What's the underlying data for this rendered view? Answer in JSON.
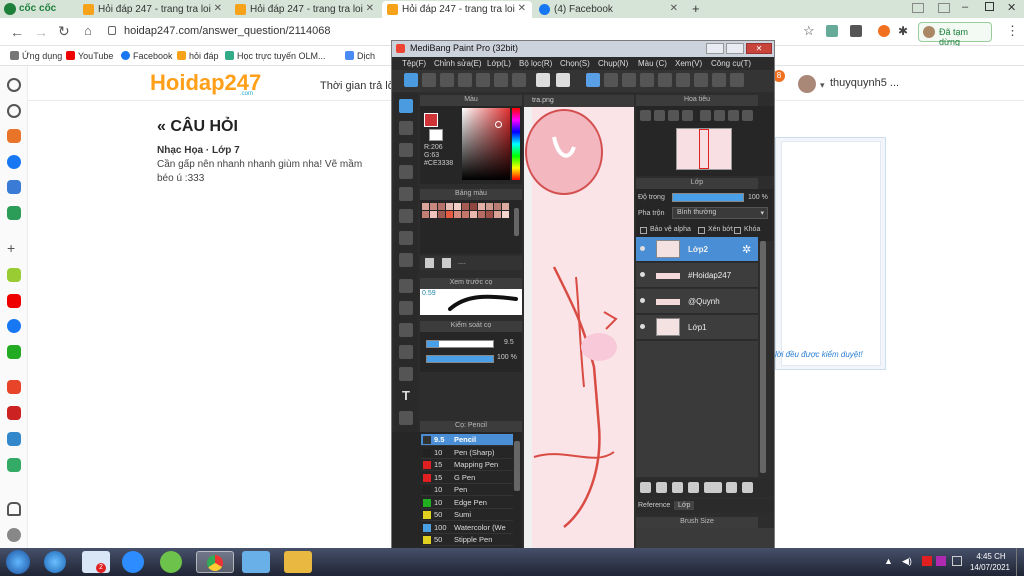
{
  "browser": {
    "name": "cốc cốc",
    "tabs": [
      {
        "title": "Hỏi đáp 247 - trang tra loi",
        "active": false
      },
      {
        "title": "Hỏi đáp 247 - trang tra loi",
        "active": false
      },
      {
        "title": "Hỏi đáp 247 - trang tra loi",
        "active": true
      },
      {
        "title": "(4) Facebook",
        "active": false
      }
    ],
    "url": "hoidap247.com/answer_question/2114068",
    "profile_label": "Đã tạm dừng",
    "bookmarks": [
      "Ứng dụng",
      "YouTube",
      "Facebook",
      "hỏi đáp",
      "Học trực tuyến OLM...",
      "Dịch"
    ],
    "colors": {
      "tabbar": "#d6e4d7",
      "accent": "#1c7f3a"
    }
  },
  "site": {
    "logo": "Hoidap247",
    "logo_sub": ".com",
    "header_text": "Thời gian trả lời",
    "notification_count": "8",
    "username": "thuyquynh5 ...",
    "question_heading": "CÂU HỎI",
    "subject": "Nhạc Họa · Lớp 7",
    "question_text": "Cần gấp nên nhanh nhanh giùm nha! Vẽ mầm béo ú :333",
    "review_note": "lời đều được kiểm duyệt!"
  },
  "medibang": {
    "title": "MediBang Paint Pro (32bit)",
    "menu": [
      "Tệp(F)",
      "Chỉnh sửa(E)",
      "Lớp(L)",
      "Bộ lọc(R)",
      "Chọn(S)",
      "Chụp(N)",
      "Màu (C)",
      "Xem(V)",
      "Công cụ(T)"
    ],
    "panels": {
      "color": "Màu",
      "palette": "Bảng màu",
      "preview": "Xem trước cọ",
      "brush_control": "Kiểm soát cọ",
      "brushes": "Cọ: Pencil",
      "navigator": "Hoa tiêu",
      "layer": "Lớp",
      "brush_size": "Brush Size",
      "canvas_tab": "tra.png"
    },
    "color_values": {
      "r": "R:206",
      "g": "G:63",
      "b": "B:?",
      "hex": "#CE3338"
    },
    "preview_size": "0.59",
    "brush_control": {
      "size": "9.5",
      "opacity": "100 %"
    },
    "palette_dots": "....",
    "layer_panel": {
      "opacity_label": "Độ trong",
      "opacity_value": "100 %",
      "opacity": 1.0,
      "blend_label": "Pha trộn",
      "blend_value": "Bình thường",
      "protect_alpha": "Bảo vệ alpha",
      "clip": "Xén bớt",
      "lock": "Khóa",
      "layers": [
        "Lớp2",
        "#Hoidap247",
        "@Quynh",
        "Lớp1"
      ]
    },
    "bottom_tabs": [
      "Reference",
      "Lớp"
    ],
    "brushes": [
      {
        "size": "9.5",
        "name": "Pencil",
        "color": "#333333"
      },
      {
        "size": "10",
        "name": "Pen (Sharp)",
        "color": "#222222"
      },
      {
        "size": "15",
        "name": "Mapping Pen",
        "color": "#e02020"
      },
      {
        "size": "15",
        "name": "G Pen",
        "color": "#e02020"
      },
      {
        "size": "10",
        "name": "Pen",
        "color": "#222222"
      },
      {
        "size": "10",
        "name": "Edge Pen",
        "color": "#20b020"
      },
      {
        "size": "50",
        "name": "Sumi",
        "color": "#e0d020"
      },
      {
        "size": "100",
        "name": "Watercolor (We",
        "color": "#4aa0e0"
      },
      {
        "size": "50",
        "name": "Stipple Pen",
        "color": "#e0d020"
      }
    ]
  },
  "taskbar": {
    "time": "4:45 CH",
    "date": "14/07/2021",
    "zalo_badge": "2"
  }
}
